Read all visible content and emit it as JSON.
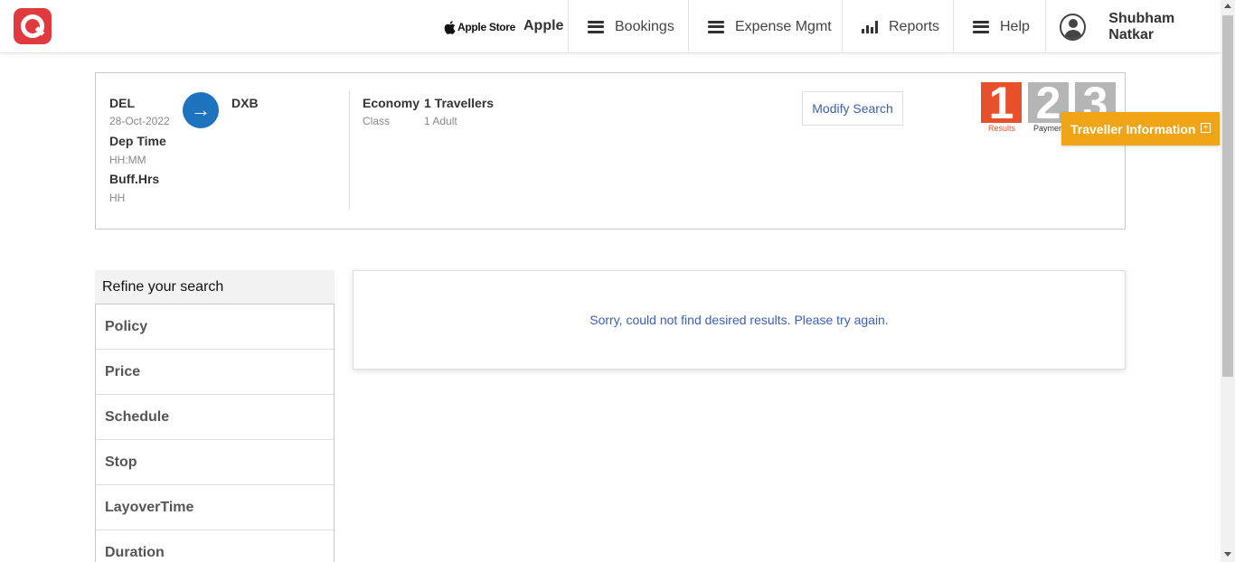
{
  "header": {
    "brand_store": "Apple Store",
    "brand_name": "Apple",
    "nav": [
      {
        "label": "Bookings",
        "icon": "menu-icon"
      },
      {
        "label": "Expense Mgmt",
        "icon": "menu-icon"
      },
      {
        "label": "Reports",
        "icon": "bar-chart-icon"
      },
      {
        "label": "Help",
        "icon": "menu-icon"
      }
    ],
    "user_name": "Shubham Natkar"
  },
  "summary": {
    "origin": "DEL",
    "date": "28-Oct-2022",
    "dep_time_label": "Dep Time",
    "dep_time_value": "HH:MM",
    "buff_label": "Buff.Hrs",
    "buff_value": "HH",
    "destination": "DXB",
    "class_value": "Economy",
    "class_label": "Class",
    "travellers_value": "1 Travellers",
    "travellers_label": "1 Adult",
    "modify_label": "Modify Search"
  },
  "steps": [
    {
      "number": "1",
      "label": "Results",
      "color": "#e8502b",
      "active": true
    },
    {
      "number": "2",
      "label": "Paymen",
      "color": "#b5b5b5",
      "active": false
    },
    {
      "number": "3",
      "label": "",
      "color": "#b5b5b5",
      "active": false
    }
  ],
  "traveller_tab": {
    "label": "Traveller Information",
    "icon": "plus-square-icon"
  },
  "refine": {
    "title": "Refine your search",
    "items": [
      "Policy",
      "Price",
      "Schedule",
      "Stop",
      "LayoverTime",
      "Duration"
    ]
  },
  "results": {
    "message": "Sorry, could not find desired results. Please try again."
  },
  "colors": {
    "accent": "#1e73be",
    "brand": "#e03a3e",
    "orange": "#f0a516",
    "link": "#3b5fb5"
  }
}
